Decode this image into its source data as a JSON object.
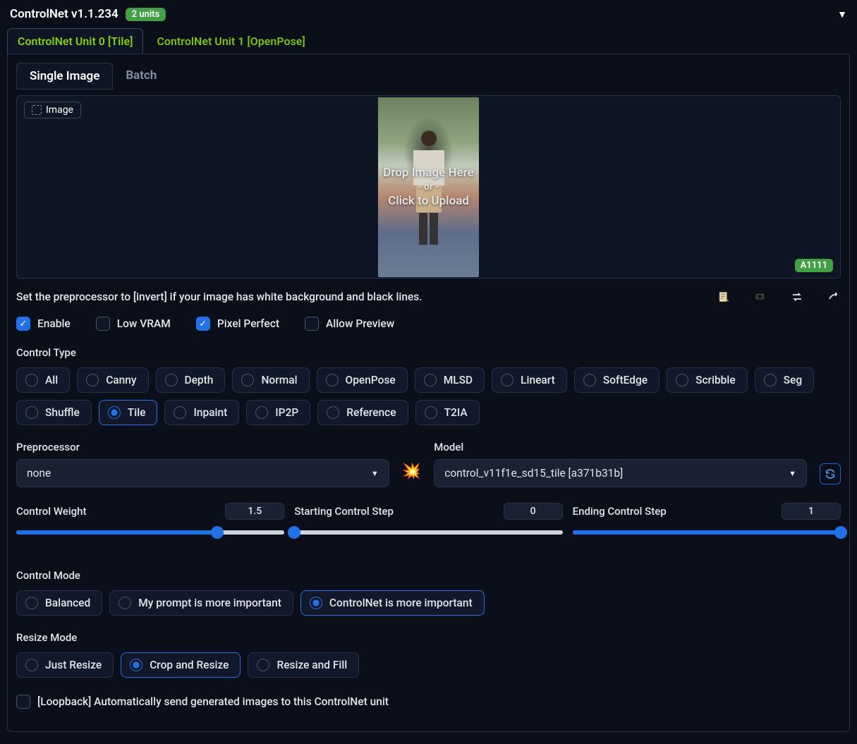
{
  "header": {
    "title": "ControlNet v1.1.234",
    "units_badge": "2 units"
  },
  "unit_tabs": [
    {
      "label": "ControlNet Unit 0 [Tile]",
      "active": true
    },
    {
      "label": "ControlNet Unit 1 [OpenPose]",
      "active": false
    }
  ],
  "sub_tabs": [
    {
      "label": "Single Image",
      "active": true
    },
    {
      "label": "Batch",
      "active": false
    }
  ],
  "image_panel": {
    "chip": "Image",
    "drop_line1": "Drop Image Here",
    "drop_or": "- or -",
    "drop_line2": "Click to Upload",
    "brand": "A1111"
  },
  "hint": "Set the preprocessor to [invert] if your image has white background and black lines.",
  "action_icons": {
    "new_canvas": "new-canvas-icon",
    "webcam": "webcam-icon",
    "swap": "swap-icon",
    "send": "send-icon"
  },
  "checkboxes": {
    "enable": {
      "label": "Enable",
      "checked": true
    },
    "low_vram": {
      "label": "Low VRAM",
      "checked": false
    },
    "pixel_perfect": {
      "label": "Pixel Perfect",
      "checked": true
    },
    "allow_preview": {
      "label": "Allow Preview",
      "checked": false
    }
  },
  "control_type": {
    "label": "Control Type",
    "options": [
      "All",
      "Canny",
      "Depth",
      "Normal",
      "OpenPose",
      "MLSD",
      "Lineart",
      "SoftEdge",
      "Scribble",
      "Seg",
      "Shuffle",
      "Tile",
      "Inpaint",
      "IP2P",
      "Reference",
      "T2IA"
    ],
    "selected": "Tile"
  },
  "preprocessor": {
    "label": "Preprocessor",
    "value": "none",
    "run_icon": "💥"
  },
  "model": {
    "label": "Model",
    "value": "control_v11f1e_sd15_tile [a371b31b]"
  },
  "sliders": {
    "weight": {
      "label": "Control Weight",
      "value": "1.5",
      "pct": 75
    },
    "start": {
      "label": "Starting Control Step",
      "value": "0",
      "pct": 0
    },
    "end": {
      "label": "Ending Control Step",
      "value": "1",
      "pct": 100
    }
  },
  "control_mode": {
    "label": "Control Mode",
    "options": [
      "Balanced",
      "My prompt is more important",
      "ControlNet is more important"
    ],
    "selected": "ControlNet is more important"
  },
  "resize_mode": {
    "label": "Resize Mode",
    "options": [
      "Just Resize",
      "Crop and Resize",
      "Resize and Fill"
    ],
    "selected": "Crop and Resize"
  },
  "loopback": {
    "label": "[Loopback] Automatically send generated images to this ControlNet unit",
    "checked": false
  }
}
